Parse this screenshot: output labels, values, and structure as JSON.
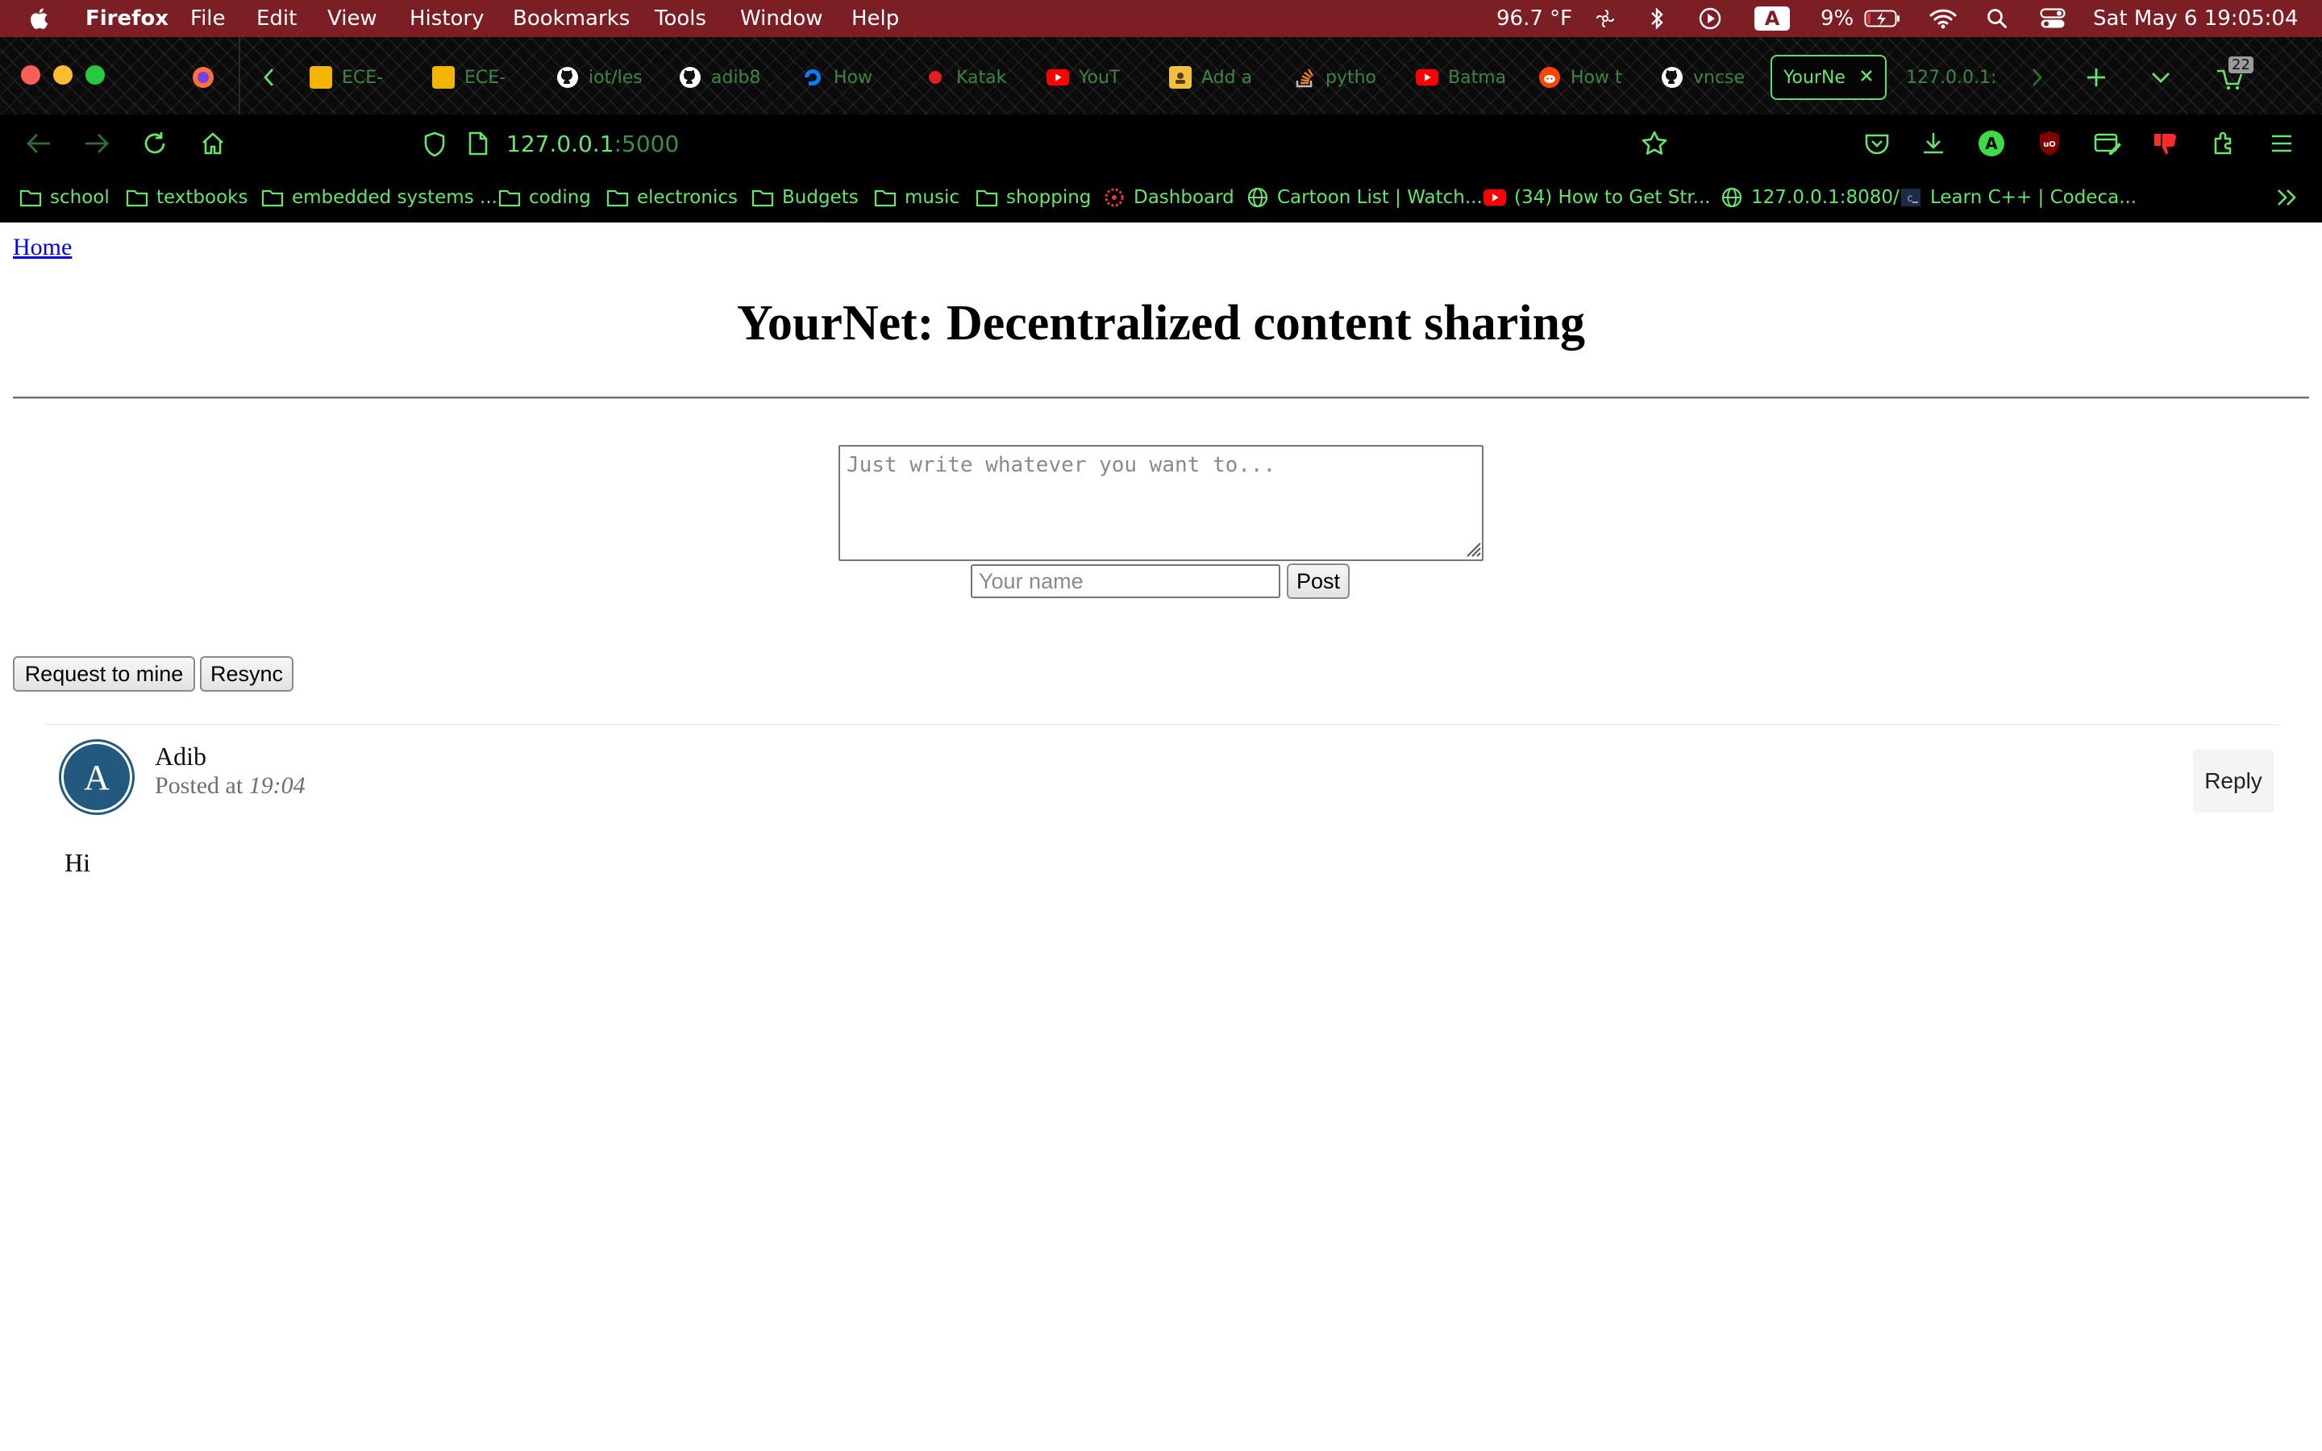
{
  "menubar": {
    "app": "Firefox",
    "menus": [
      "File",
      "Edit",
      "View",
      "History",
      "Bookmarks",
      "Tools",
      "Window",
      "Help"
    ],
    "temperature": "96.7 °F",
    "input_source": "A",
    "battery": "9%",
    "datetime": "Sat May 6  19:05:04"
  },
  "tabs": [
    {
      "label": "ECE-",
      "icon": "slides-icon",
      "color": "#f4b400"
    },
    {
      "label": "ECE-",
      "icon": "slides-icon",
      "color": "#f4b400"
    },
    {
      "label": "iot/les",
      "icon": "github-icon",
      "color": "#ffffff"
    },
    {
      "label": "adib8",
      "icon": "github-icon",
      "color": "#ffffff"
    },
    {
      "label": "How",
      "icon": "digitalocean-icon",
      "color": "#0080ff"
    },
    {
      "label": "Katak",
      "icon": "record-icon",
      "color": "#e02020"
    },
    {
      "label": "YouT",
      "icon": "youtube-icon",
      "color": "#ff0000"
    },
    {
      "label": "Add a",
      "icon": "addon-icon",
      "color": "#f0c040"
    },
    {
      "label": "pytho",
      "icon": "stackoverflow-icon",
      "color": "#f48024"
    },
    {
      "label": "Batma",
      "icon": "youtube-icon",
      "color": "#ff0000"
    },
    {
      "label": "How t",
      "icon": "reddit-icon",
      "color": "#ff4500"
    },
    {
      "label": "vncse",
      "icon": "github-icon",
      "color": "#ffffff"
    },
    {
      "label": "YourNe",
      "icon": "",
      "color": "#67e46c",
      "active": true
    },
    {
      "label": "127.0.0.1:",
      "icon": "",
      "color": "#67e46c"
    }
  ],
  "tab_count": "22",
  "navbar": {
    "url_host": "127.0.0.1",
    "url_port": ":5000"
  },
  "bookmarks": [
    {
      "label": "school",
      "icon": "folder-icon"
    },
    {
      "label": "textbooks",
      "icon": "folder-icon"
    },
    {
      "label": "embedded systems ...",
      "icon": "folder-icon"
    },
    {
      "label": "coding",
      "icon": "folder-icon"
    },
    {
      "label": "electronics",
      "icon": "folder-icon"
    },
    {
      "label": "Budgets",
      "icon": "folder-icon"
    },
    {
      "label": "music",
      "icon": "folder-icon"
    },
    {
      "label": "shopping",
      "icon": "folder-icon"
    },
    {
      "label": "Dashboard",
      "icon": "canvas-icon"
    },
    {
      "label": "Cartoon List | Watch...",
      "icon": "globe-icon"
    },
    {
      "label": "(34) How to Get Str...",
      "icon": "youtube-icon"
    },
    {
      "label": "127.0.0.1:8080/",
      "icon": "globe-icon"
    },
    {
      "label": "Learn C++ | Codeca...",
      "icon": "codecademy-icon"
    }
  ],
  "page": {
    "home_link": "Home",
    "title": "YourNet: Decentralized content sharing",
    "post_placeholder": "Just write whatever you want to...",
    "name_placeholder": "Your name",
    "post_button": "Post",
    "request_button": "Request to mine",
    "resync_button": "Resync",
    "post": {
      "avatar_letter": "A",
      "author": "Adib",
      "posted_prefix": "Posted at ",
      "posted_time": "19:04",
      "reply": "Reply",
      "body": "Hi"
    }
  },
  "colors": {
    "menubar_bg": "#7c1f24",
    "theme_green": "#67e46c",
    "avatar": "#24597f",
    "link": "#0000ee"
  }
}
